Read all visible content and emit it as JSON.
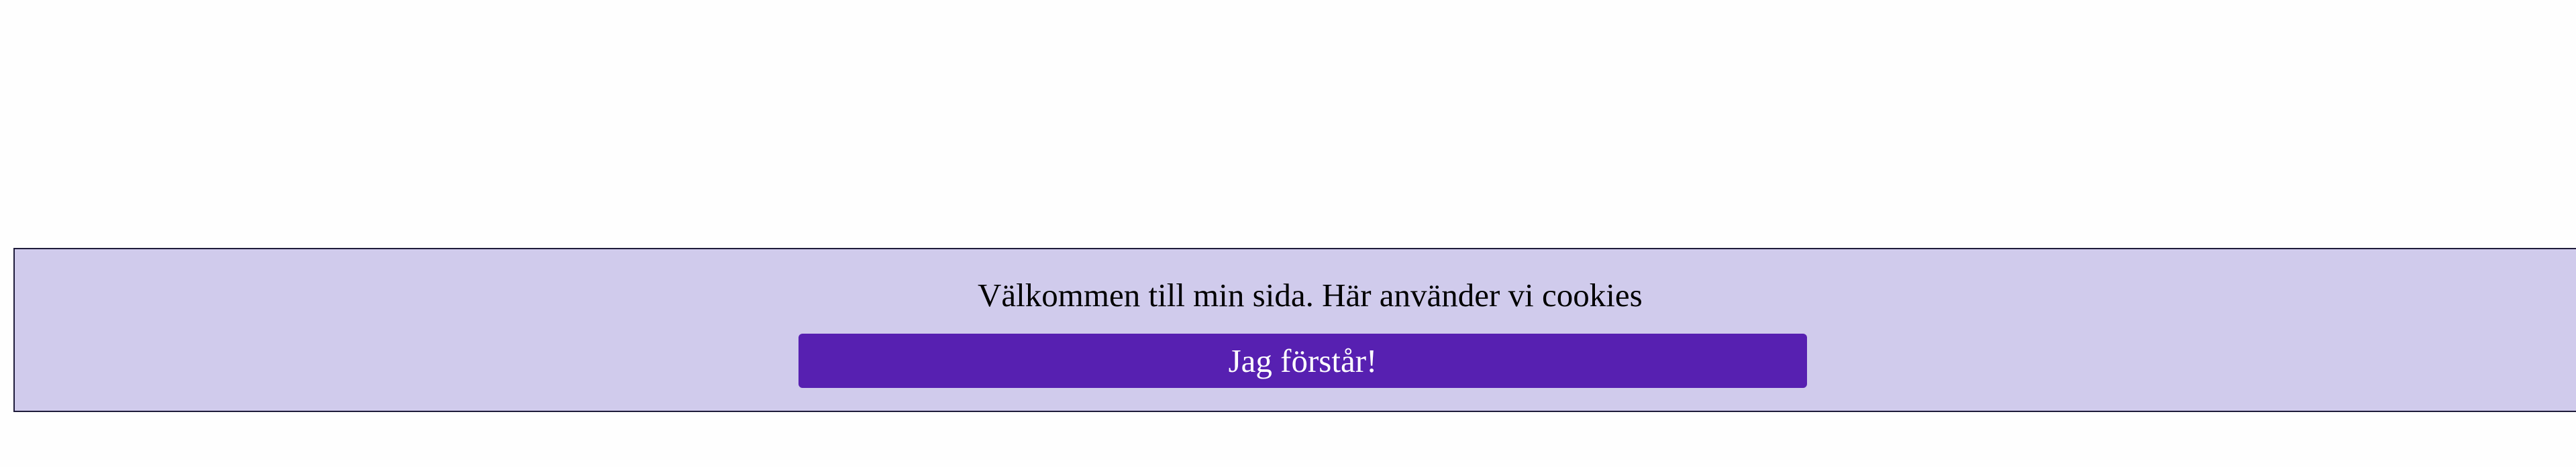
{
  "cookie_banner": {
    "message": "Välkommen till min sida. Här använder vi cookies",
    "accept_label": "Jag förstår!",
    "colors": {
      "banner_background": "#d0cbec",
      "banner_border": "#1e1b3a",
      "button_background": "#5720b1",
      "button_text": "#ffffff"
    }
  }
}
